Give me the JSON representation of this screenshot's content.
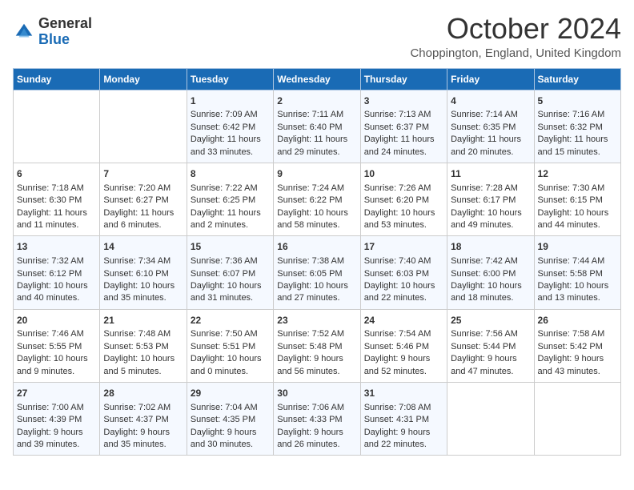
{
  "header": {
    "logo_general": "General",
    "logo_blue": "Blue",
    "month_title": "October 2024",
    "location": "Choppington, England, United Kingdom"
  },
  "days_of_week": [
    "Sunday",
    "Monday",
    "Tuesday",
    "Wednesday",
    "Thursday",
    "Friday",
    "Saturday"
  ],
  "weeks": [
    [
      {
        "day": "",
        "sunrise": "",
        "sunset": "",
        "daylight": ""
      },
      {
        "day": "",
        "sunrise": "",
        "sunset": "",
        "daylight": ""
      },
      {
        "day": "1",
        "sunrise": "Sunrise: 7:09 AM",
        "sunset": "Sunset: 6:42 PM",
        "daylight": "Daylight: 11 hours and 33 minutes."
      },
      {
        "day": "2",
        "sunrise": "Sunrise: 7:11 AM",
        "sunset": "Sunset: 6:40 PM",
        "daylight": "Daylight: 11 hours and 29 minutes."
      },
      {
        "day": "3",
        "sunrise": "Sunrise: 7:13 AM",
        "sunset": "Sunset: 6:37 PM",
        "daylight": "Daylight: 11 hours and 24 minutes."
      },
      {
        "day": "4",
        "sunrise": "Sunrise: 7:14 AM",
        "sunset": "Sunset: 6:35 PM",
        "daylight": "Daylight: 11 hours and 20 minutes."
      },
      {
        "day": "5",
        "sunrise": "Sunrise: 7:16 AM",
        "sunset": "Sunset: 6:32 PM",
        "daylight": "Daylight: 11 hours and 15 minutes."
      }
    ],
    [
      {
        "day": "6",
        "sunrise": "Sunrise: 7:18 AM",
        "sunset": "Sunset: 6:30 PM",
        "daylight": "Daylight: 11 hours and 11 minutes."
      },
      {
        "day": "7",
        "sunrise": "Sunrise: 7:20 AM",
        "sunset": "Sunset: 6:27 PM",
        "daylight": "Daylight: 11 hours and 6 minutes."
      },
      {
        "day": "8",
        "sunrise": "Sunrise: 7:22 AM",
        "sunset": "Sunset: 6:25 PM",
        "daylight": "Daylight: 11 hours and 2 minutes."
      },
      {
        "day": "9",
        "sunrise": "Sunrise: 7:24 AM",
        "sunset": "Sunset: 6:22 PM",
        "daylight": "Daylight: 10 hours and 58 minutes."
      },
      {
        "day": "10",
        "sunrise": "Sunrise: 7:26 AM",
        "sunset": "Sunset: 6:20 PM",
        "daylight": "Daylight: 10 hours and 53 minutes."
      },
      {
        "day": "11",
        "sunrise": "Sunrise: 7:28 AM",
        "sunset": "Sunset: 6:17 PM",
        "daylight": "Daylight: 10 hours and 49 minutes."
      },
      {
        "day": "12",
        "sunrise": "Sunrise: 7:30 AM",
        "sunset": "Sunset: 6:15 PM",
        "daylight": "Daylight: 10 hours and 44 minutes."
      }
    ],
    [
      {
        "day": "13",
        "sunrise": "Sunrise: 7:32 AM",
        "sunset": "Sunset: 6:12 PM",
        "daylight": "Daylight: 10 hours and 40 minutes."
      },
      {
        "day": "14",
        "sunrise": "Sunrise: 7:34 AM",
        "sunset": "Sunset: 6:10 PM",
        "daylight": "Daylight: 10 hours and 35 minutes."
      },
      {
        "day": "15",
        "sunrise": "Sunrise: 7:36 AM",
        "sunset": "Sunset: 6:07 PM",
        "daylight": "Daylight: 10 hours and 31 minutes."
      },
      {
        "day": "16",
        "sunrise": "Sunrise: 7:38 AM",
        "sunset": "Sunset: 6:05 PM",
        "daylight": "Daylight: 10 hours and 27 minutes."
      },
      {
        "day": "17",
        "sunrise": "Sunrise: 7:40 AM",
        "sunset": "Sunset: 6:03 PM",
        "daylight": "Daylight: 10 hours and 22 minutes."
      },
      {
        "day": "18",
        "sunrise": "Sunrise: 7:42 AM",
        "sunset": "Sunset: 6:00 PM",
        "daylight": "Daylight: 10 hours and 18 minutes."
      },
      {
        "day": "19",
        "sunrise": "Sunrise: 7:44 AM",
        "sunset": "Sunset: 5:58 PM",
        "daylight": "Daylight: 10 hours and 13 minutes."
      }
    ],
    [
      {
        "day": "20",
        "sunrise": "Sunrise: 7:46 AM",
        "sunset": "Sunset: 5:55 PM",
        "daylight": "Daylight: 10 hours and 9 minutes."
      },
      {
        "day": "21",
        "sunrise": "Sunrise: 7:48 AM",
        "sunset": "Sunset: 5:53 PM",
        "daylight": "Daylight: 10 hours and 5 minutes."
      },
      {
        "day": "22",
        "sunrise": "Sunrise: 7:50 AM",
        "sunset": "Sunset: 5:51 PM",
        "daylight": "Daylight: 10 hours and 0 minutes."
      },
      {
        "day": "23",
        "sunrise": "Sunrise: 7:52 AM",
        "sunset": "Sunset: 5:48 PM",
        "daylight": "Daylight: 9 hours and 56 minutes."
      },
      {
        "day": "24",
        "sunrise": "Sunrise: 7:54 AM",
        "sunset": "Sunset: 5:46 PM",
        "daylight": "Daylight: 9 hours and 52 minutes."
      },
      {
        "day": "25",
        "sunrise": "Sunrise: 7:56 AM",
        "sunset": "Sunset: 5:44 PM",
        "daylight": "Daylight: 9 hours and 47 minutes."
      },
      {
        "day": "26",
        "sunrise": "Sunrise: 7:58 AM",
        "sunset": "Sunset: 5:42 PM",
        "daylight": "Daylight: 9 hours and 43 minutes."
      }
    ],
    [
      {
        "day": "27",
        "sunrise": "Sunrise: 7:00 AM",
        "sunset": "Sunset: 4:39 PM",
        "daylight": "Daylight: 9 hours and 39 minutes."
      },
      {
        "day": "28",
        "sunrise": "Sunrise: 7:02 AM",
        "sunset": "Sunset: 4:37 PM",
        "daylight": "Daylight: 9 hours and 35 minutes."
      },
      {
        "day": "29",
        "sunrise": "Sunrise: 7:04 AM",
        "sunset": "Sunset: 4:35 PM",
        "daylight": "Daylight: 9 hours and 30 minutes."
      },
      {
        "day": "30",
        "sunrise": "Sunrise: 7:06 AM",
        "sunset": "Sunset: 4:33 PM",
        "daylight": "Daylight: 9 hours and 26 minutes."
      },
      {
        "day": "31",
        "sunrise": "Sunrise: 7:08 AM",
        "sunset": "Sunset: 4:31 PM",
        "daylight": "Daylight: 9 hours and 22 minutes."
      },
      {
        "day": "",
        "sunrise": "",
        "sunset": "",
        "daylight": ""
      },
      {
        "day": "",
        "sunrise": "",
        "sunset": "",
        "daylight": ""
      }
    ]
  ]
}
